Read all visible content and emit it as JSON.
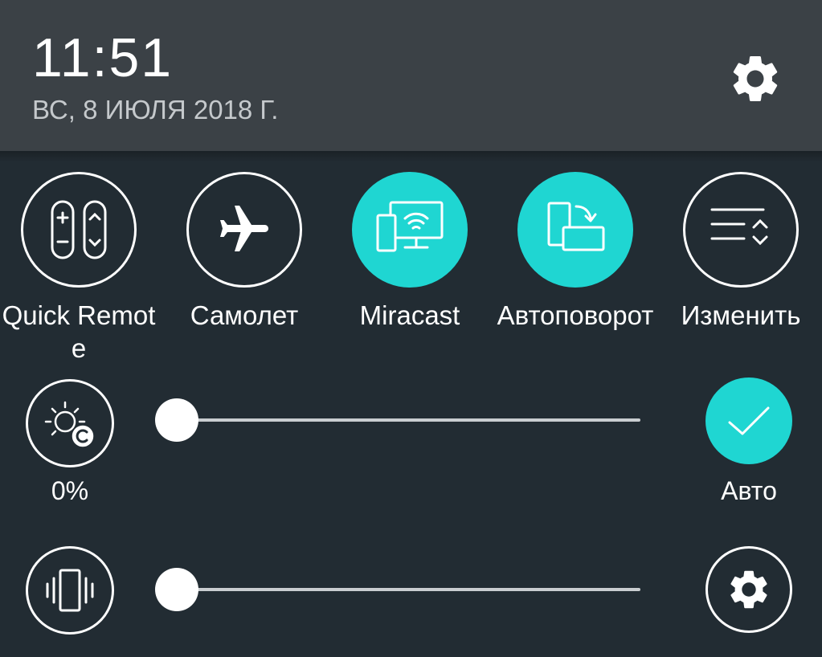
{
  "header": {
    "time": "11:51",
    "date": "ВС, 8 ИЮЛЯ 2018 Г.",
    "settings_icon": "gear-icon"
  },
  "quick_settings": [
    {
      "label": "Quick Remote",
      "icon": "quick-remote-icon",
      "active": false
    },
    {
      "label": "Самолет",
      "icon": "airplane-icon",
      "active": false
    },
    {
      "label": "Miracast",
      "icon": "miracast-icon",
      "active": true
    },
    {
      "label": "Автоповорот",
      "icon": "auto-rotate-icon",
      "active": true
    },
    {
      "label": "Изменить",
      "icon": "edit-list-icon",
      "active": false
    }
  ],
  "brightness": {
    "value_label": "0%",
    "level": 0,
    "icon": "brightness-icon",
    "auto_label": "Авто",
    "auto_enabled": true,
    "auto_icon": "checkmark-icon"
  },
  "volume": {
    "level": 0,
    "icon": "vibrate-icon",
    "settings_icon": "gear-icon"
  },
  "colors": {
    "accent": "#1fd6d2",
    "header_bg": "#3b4146",
    "panel_bg": "#222c33"
  }
}
